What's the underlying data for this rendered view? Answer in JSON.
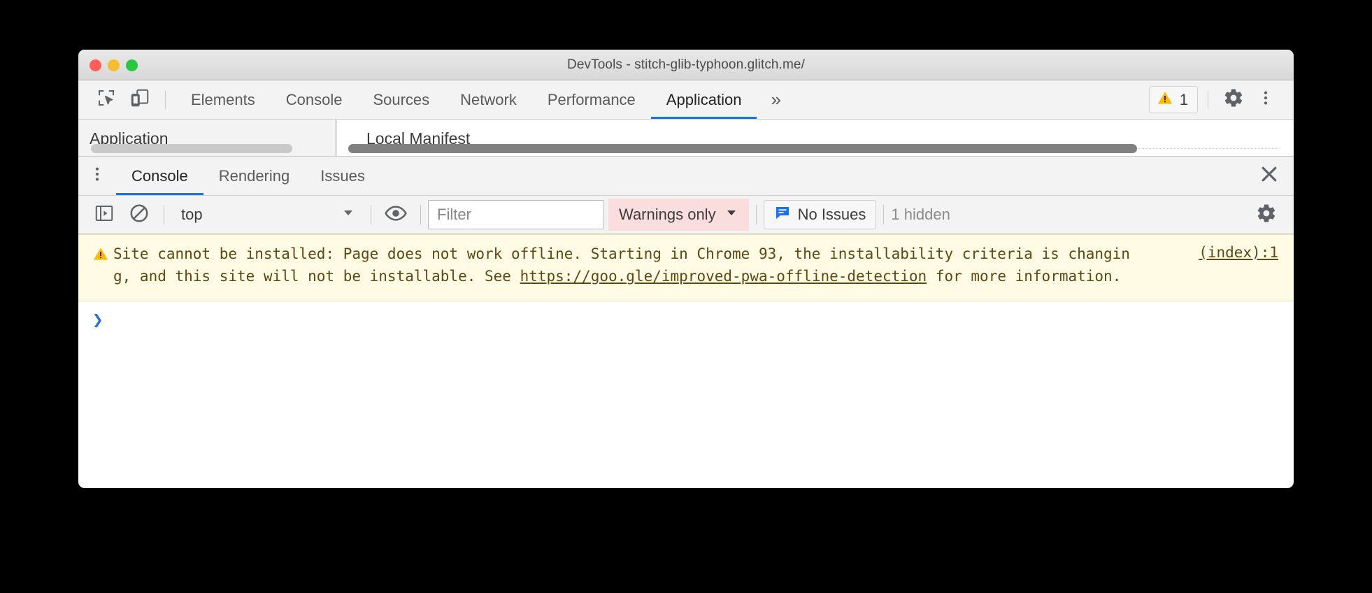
{
  "window": {
    "title": "DevTools - stitch-glib-typhoon.glitch.me/",
    "traffic_lights": {
      "close": "close-window",
      "minimize": "minimize-window",
      "maximize": "maximize-window"
    }
  },
  "devtools_toolbar": {
    "inspect_icon": "inspect-element-icon",
    "device_toolbar_icon": "device-toolbar-icon",
    "tabs": [
      {
        "label": "Elements",
        "active": false
      },
      {
        "label": "Console",
        "active": false
      },
      {
        "label": "Sources",
        "active": false
      },
      {
        "label": "Network",
        "active": false
      },
      {
        "label": "Performance",
        "active": false
      },
      {
        "label": "Application",
        "active": true
      }
    ],
    "more_tabs_label": "»",
    "warning_badge": {
      "icon": "warning-triangle-icon",
      "count": "1"
    },
    "settings_icon": "gear-icon",
    "menu_icon": "kebab-menu-icon"
  },
  "panel_strip": {
    "sidebar_title": "Application",
    "content_title": "Local Manifest",
    "scrollbar_light": "horizontal-scrollbar",
    "scrollbar_dark": "horizontal-scrollbar"
  },
  "drawer": {
    "menu_icon": "kebab-menu-icon",
    "tabs": [
      {
        "label": "Console",
        "active": true
      },
      {
        "label": "Rendering",
        "active": false
      },
      {
        "label": "Issues",
        "active": false
      }
    ],
    "close_label": "✕"
  },
  "console_toolbar": {
    "sidebar_toggle_icon": "console-sidebar-toggle-icon",
    "clear_icon": "clear-console-icon",
    "context": {
      "value": "top",
      "caret": "▼"
    },
    "eye_icon": "live-expression-eye-icon",
    "filter": {
      "placeholder": "Filter",
      "value": ""
    },
    "level": {
      "value": "Warnings only",
      "caret": "▼"
    },
    "issues_button": {
      "icon": "issues-speech-bubble-icon",
      "label": "No Issues"
    },
    "hidden_count": "1 hidden",
    "settings_icon": "gear-icon"
  },
  "console": {
    "messages": [
      {
        "level": "warning",
        "icon": "warning-triangle-icon",
        "text_before": "Site cannot be installed: Page does not work offline. Starting in Chrome 93, the installability criteria is changing, and this site will not be installable. See ",
        "link_text": "https://goo.gle/improved-pwa-offline-detection",
        "text_after": " for more information.",
        "source": "(index):1"
      }
    ],
    "prompt": {
      "chevron": "❯",
      "value": ""
    }
  },
  "colors": {
    "accent": "#1a73e8",
    "warning_bg": "#fffbe5",
    "warning_text": "#5c4813",
    "level_filter_bg": "#fadddd",
    "prompt": "#2a6fd6"
  }
}
